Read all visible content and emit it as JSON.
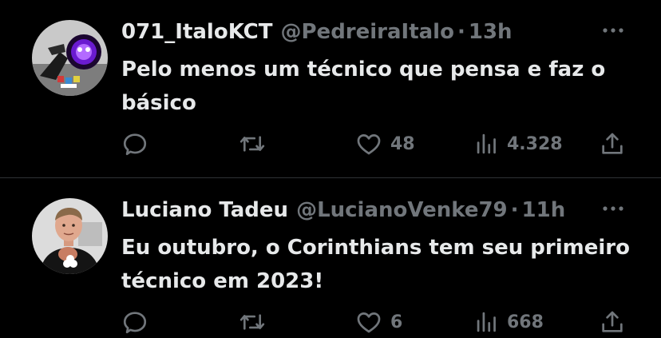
{
  "tweets": [
    {
      "display_name": "071_ItaloKCT",
      "handle": "@PedreiraItalo",
      "separator": "·",
      "time": "13h",
      "text": "Pelo menos um técnico que pensa e faz o básico",
      "actions": {
        "reply_icon": "reply-icon",
        "retweet_icon": "retweet-icon",
        "like_icon": "heart-icon",
        "like_count": "48",
        "views_icon": "views-icon",
        "views_count": "4.328",
        "share_icon": "share-icon"
      }
    },
    {
      "display_name": "Luciano Tadeu",
      "handle": "@LucianoVenke79",
      "separator": "·",
      "time": "11h",
      "text": "Eu outubro, o Corinthians tem seu primeiro técnico em 2023!",
      "actions": {
        "reply_icon": "reply-icon",
        "retweet_icon": "retweet-icon",
        "like_icon": "heart-icon",
        "like_count": "6",
        "views_icon": "views-icon",
        "views_count": "668",
        "share_icon": "share-icon"
      }
    }
  ],
  "colors": {
    "background": "#000000",
    "primary_text": "#e7e9ea",
    "secondary_text": "#71767b",
    "divider": "#2f3336"
  }
}
